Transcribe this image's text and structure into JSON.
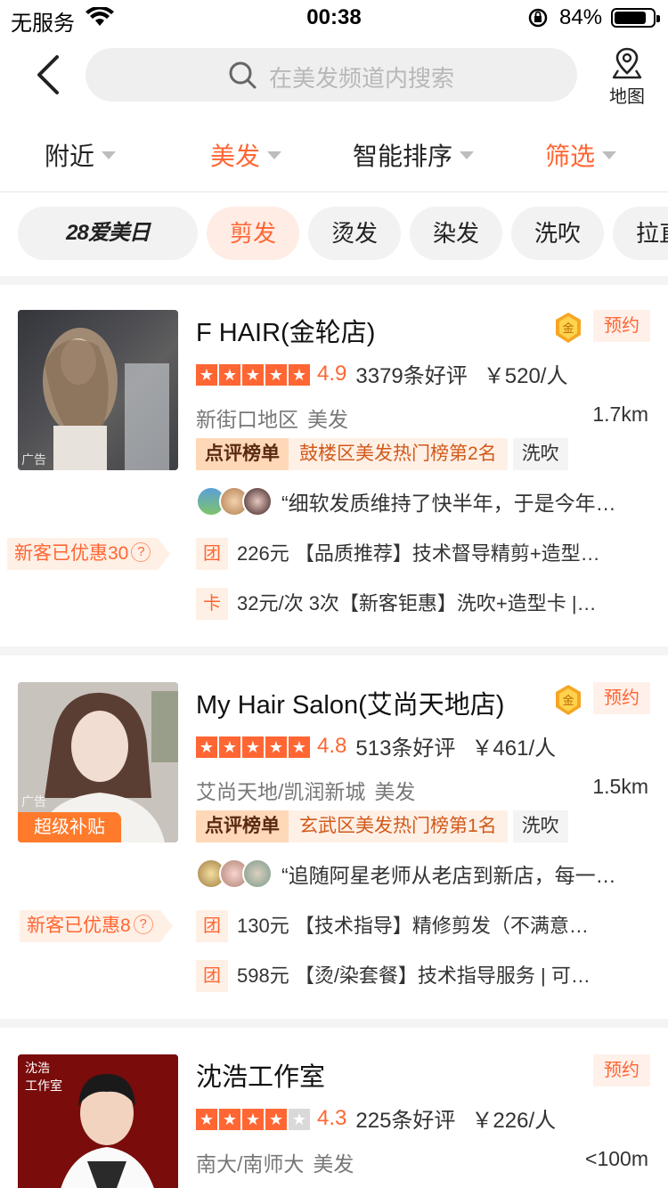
{
  "status_bar": {
    "carrier": "无服务",
    "time": "00:38",
    "battery": "84%",
    "battery_level": 0.84
  },
  "header": {
    "search_placeholder": "在美发频道内搜索",
    "map_label": "地图"
  },
  "filters": [
    {
      "label": "附近",
      "active": false
    },
    {
      "label": "美发",
      "active": true
    },
    {
      "label": "智能排序",
      "active": false
    },
    {
      "label": "筛选",
      "active": true
    }
  ],
  "chips": [
    {
      "label": "28爱美日",
      "logo": true
    },
    {
      "label": "剪发",
      "active": true
    },
    {
      "label": "烫发"
    },
    {
      "label": "染发"
    },
    {
      "label": "洗吹"
    },
    {
      "label": "拉直"
    }
  ],
  "shops": [
    {
      "name": "F HAIR(金轮店)",
      "reserve": "预约",
      "gold_badge": "金",
      "ad_label": "广告",
      "stars": 5,
      "score": "4.9",
      "reviews": "3379条好评",
      "price": "￥520/人",
      "area": "新街口地区",
      "category": "美发",
      "distance": "1.7km",
      "rank_label": "点评榜单",
      "rank_text": "鼓楼区美发热门榜第2名",
      "rank_tag": "洗吹",
      "review": "“细软发质维持了快半年，于是今年…",
      "promo": "新客已优惠30",
      "deals": [
        {
          "badge": "团",
          "text": "226元 【品质推荐】技术督导精剪+造型…"
        },
        {
          "badge": "卡",
          "text": "32元/次 3次【新客钜惠】洗吹+造型卡 |…"
        }
      ]
    },
    {
      "name": "My Hair Salon(艾尚天地店)",
      "reserve": "预约",
      "gold_badge": "金",
      "ad_label": "广告",
      "subsidy": "超级补贴",
      "stars": 5,
      "score": "4.8",
      "reviews": "513条好评",
      "price": "￥461/人",
      "area": "艾尚天地/凯润新城",
      "category": "美发",
      "distance": "1.5km",
      "rank_label": "点评榜单",
      "rank_text": "玄武区美发热门榜第1名",
      "rank_tag": "洗吹",
      "review": "“追随阿星老师从老店到新店，每一…",
      "promo": "新客已优惠8",
      "deals": [
        {
          "badge": "团",
          "text": "130元 【技术指导】精修剪发（不满意…"
        },
        {
          "badge": "团",
          "text": "598元 【烫/染套餐】技术指导服务 | 可…"
        }
      ]
    },
    {
      "name": "沈浩工作室",
      "reserve": "预约",
      "thumb_text": "沈浩 工作室",
      "stars": 4,
      "score": "4.3",
      "reviews": "225条好评",
      "price": "￥226/人",
      "area": "南大/南师大",
      "category": "美发",
      "distance": "<100m"
    }
  ],
  "colors": {
    "accent": "#ff6633",
    "rank_bg": "#ffd8b8",
    "subsidy": "#ff7a2b"
  },
  "icons": [
    "wifi-icon",
    "orientation-lock-icon",
    "battery-icon",
    "back-arrow-icon",
    "search-icon",
    "map-pin-icon",
    "gold-medal-icon",
    "star-icon",
    "question-icon"
  ]
}
